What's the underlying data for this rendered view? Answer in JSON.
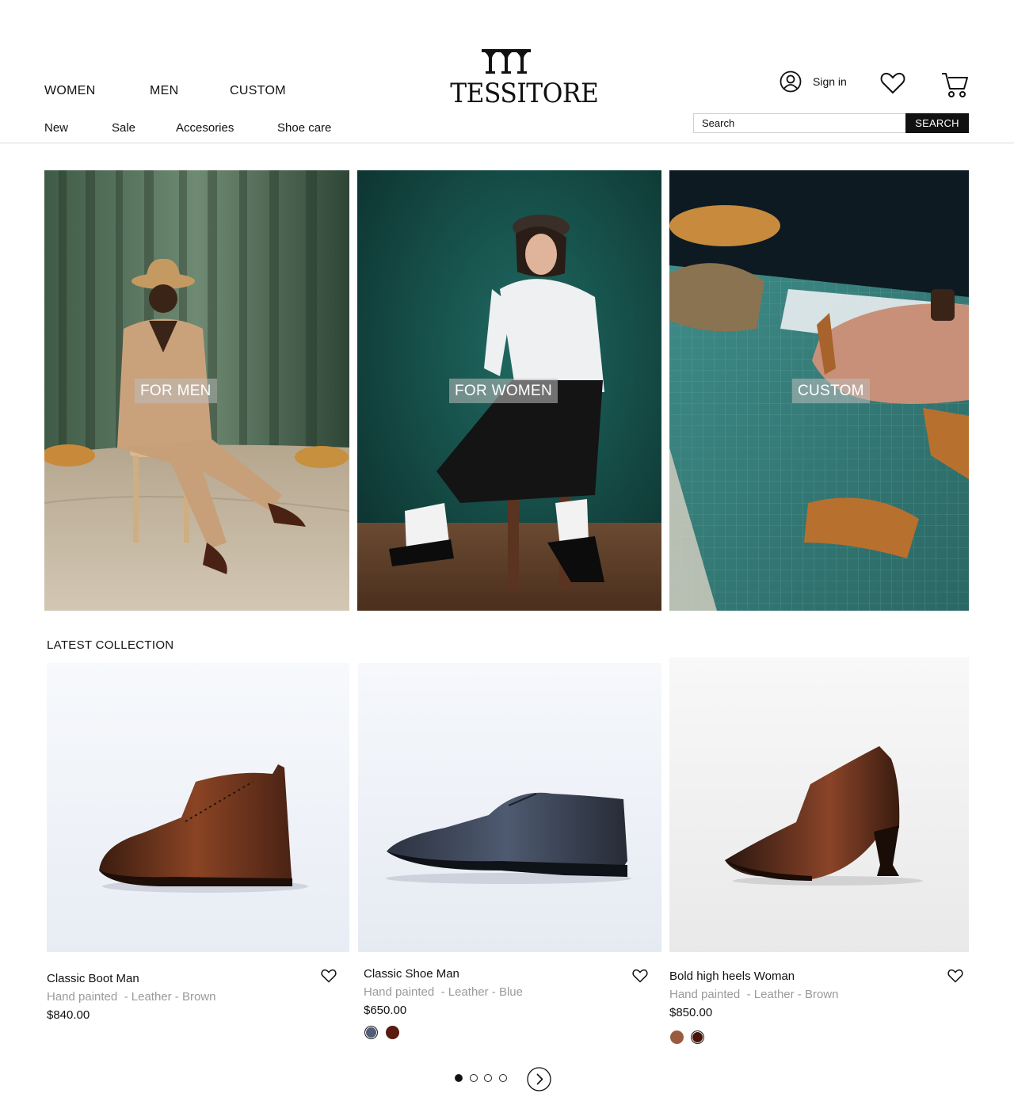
{
  "brand": {
    "name": "TESSITORE"
  },
  "nav": {
    "main": [
      "WOMEN",
      "MEN",
      "CUSTOM"
    ],
    "sub": [
      "New",
      "Sale",
      "Accesories",
      "Shoe care"
    ]
  },
  "account": {
    "sign_in": "Sign in",
    "icons": [
      "user-icon",
      "heart-icon",
      "cart-icon"
    ]
  },
  "search": {
    "placeholder": "Search",
    "button": "SEARCH"
  },
  "hero": [
    {
      "label": "FOR MEN"
    },
    {
      "label": "FOR WOMEN"
    },
    {
      "label": "CUSTOM"
    }
  ],
  "collection": {
    "title": "LATEST COLLECTION",
    "products": [
      {
        "name": "Classic Boot Man",
        "finish": "Hand painted",
        "details": "- Leather - Brown",
        "price": "$840.00",
        "swatches": []
      },
      {
        "name": "Classic Shoe Man",
        "finish": "Hand painted",
        "details": "- Leather - Blue",
        "price": "$650.00",
        "swatches": [
          "#4f5d78",
          "#5a1a0e"
        ],
        "selected_swatch": 0
      },
      {
        "name": "Bold high heels Woman",
        "finish": "Hand painted",
        "details": "- Leather - Brown",
        "price": "$850.00",
        "swatches": [
          "#9b5b3e",
          "#4a1408"
        ],
        "selected_swatch": 1
      }
    ]
  },
  "carousel": {
    "pages": 4,
    "active_page": 1
  },
  "colors": {
    "text": "#111111",
    "muted": "#9a9a9a",
    "button_bg": "#111111",
    "divider": "#d9d9d9"
  }
}
